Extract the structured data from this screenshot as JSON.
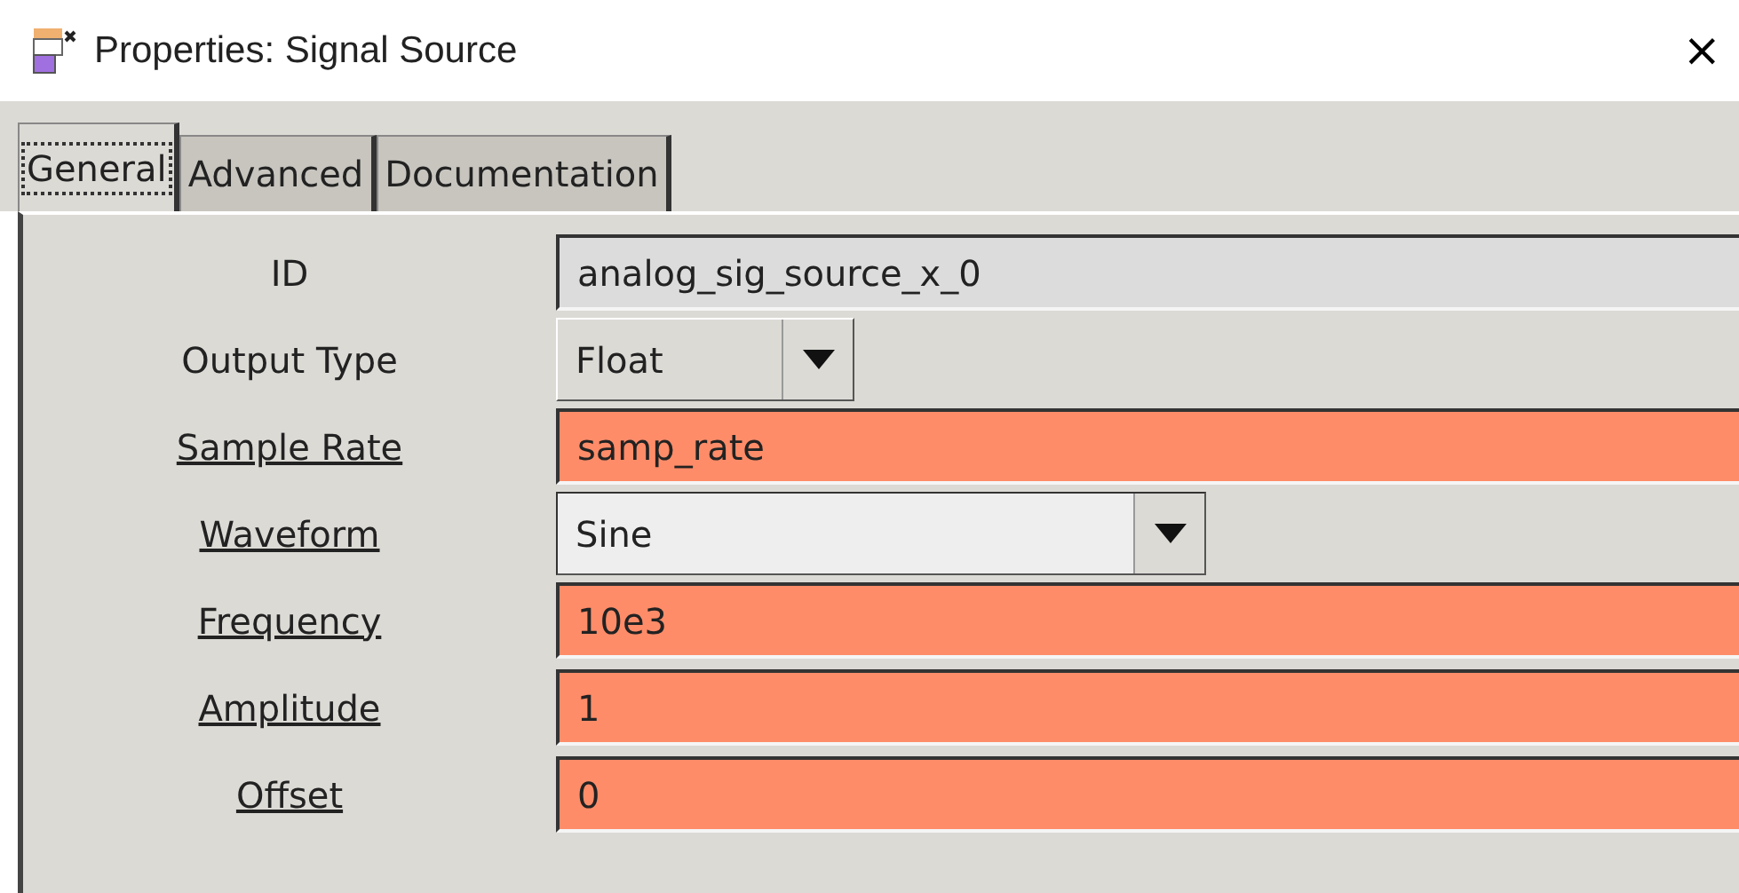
{
  "window": {
    "title": "Properties: Signal Source",
    "close": "×"
  },
  "tabs": [
    {
      "label": "General",
      "selected": true
    },
    {
      "label": "Advanced",
      "selected": false
    },
    {
      "label": "Documentation",
      "selected": false
    }
  ],
  "params": [
    {
      "label": "ID",
      "underlined": false,
      "kind": "entry",
      "value": "analog_sig_source_x_0",
      "color": "#dcdcdc"
    },
    {
      "label": "Output Type",
      "underlined": false,
      "kind": "enum",
      "value": "Float",
      "wide": false
    },
    {
      "label": "Sample Rate",
      "underlined": true,
      "kind": "entry",
      "value": "samp_rate",
      "color": "#ff8c69"
    },
    {
      "label": "Waveform",
      "underlined": true,
      "kind": "enum",
      "value": "Sine",
      "wide": true
    },
    {
      "label": "Frequency",
      "underlined": true,
      "kind": "entry",
      "value": "10e3",
      "color": "#ff8c69"
    },
    {
      "label": "Amplitude",
      "underlined": true,
      "kind": "entry",
      "value": "1",
      "color": "#ff8c69"
    },
    {
      "label": "Offset",
      "underlined": true,
      "kind": "entry",
      "value": "0",
      "color": "#ff8c69"
    }
  ]
}
